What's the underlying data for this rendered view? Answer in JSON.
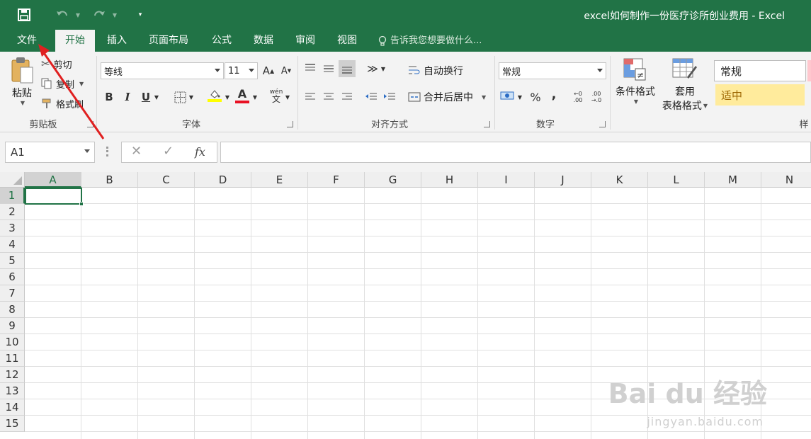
{
  "window": {
    "title": "excel如何制作一份医疗诊所创业费用 - Excel"
  },
  "tabs": [
    {
      "label": "文件"
    },
    {
      "label": "开始"
    },
    {
      "label": "插入"
    },
    {
      "label": "页面布局"
    },
    {
      "label": "公式"
    },
    {
      "label": "数据"
    },
    {
      "label": "审阅"
    },
    {
      "label": "视图"
    }
  ],
  "tellme": {
    "text": "告诉我您想要做什么..."
  },
  "clipboard": {
    "paste": "粘贴",
    "cut": "剪切",
    "copy": "复制",
    "format_painter": "格式刷",
    "label": "剪贴板"
  },
  "font": {
    "name": "等线",
    "size": "11",
    "bold": "B",
    "italic": "I",
    "underline": "U",
    "label": "字体",
    "fill_color": "#ffff00",
    "font_color": "#e81123"
  },
  "alignment": {
    "wrap_text": "自动换行",
    "merge_center": "合并后居中",
    "label": "对齐方式"
  },
  "number": {
    "format": "常规",
    "percent": "%",
    "comma": ",",
    "label": "数字"
  },
  "styles": {
    "conditional": "条件格式",
    "table_style_line1": "套用",
    "table_style_line2": "表格格式",
    "normal": "常规",
    "neutral": "适中",
    "label": "样"
  },
  "formula_bar": {
    "name_box": "A1",
    "fx": "fx",
    "value": ""
  },
  "grid": {
    "columns": [
      "A",
      "B",
      "C",
      "D",
      "E",
      "F",
      "G",
      "H",
      "I",
      "J",
      "K",
      "L",
      "M",
      "N"
    ],
    "rows": [
      "1",
      "2",
      "3",
      "4",
      "5",
      "6",
      "7",
      "8",
      "9",
      "10",
      "11",
      "12",
      "13",
      "14",
      "15"
    ],
    "selected_column": "A",
    "selected_row": "1"
  },
  "watermark": {
    "brand": "Bai du 经验",
    "url": "jingyan.baidu.com"
  },
  "colors": {
    "accent": "#217346",
    "annotation": "#e02020"
  }
}
